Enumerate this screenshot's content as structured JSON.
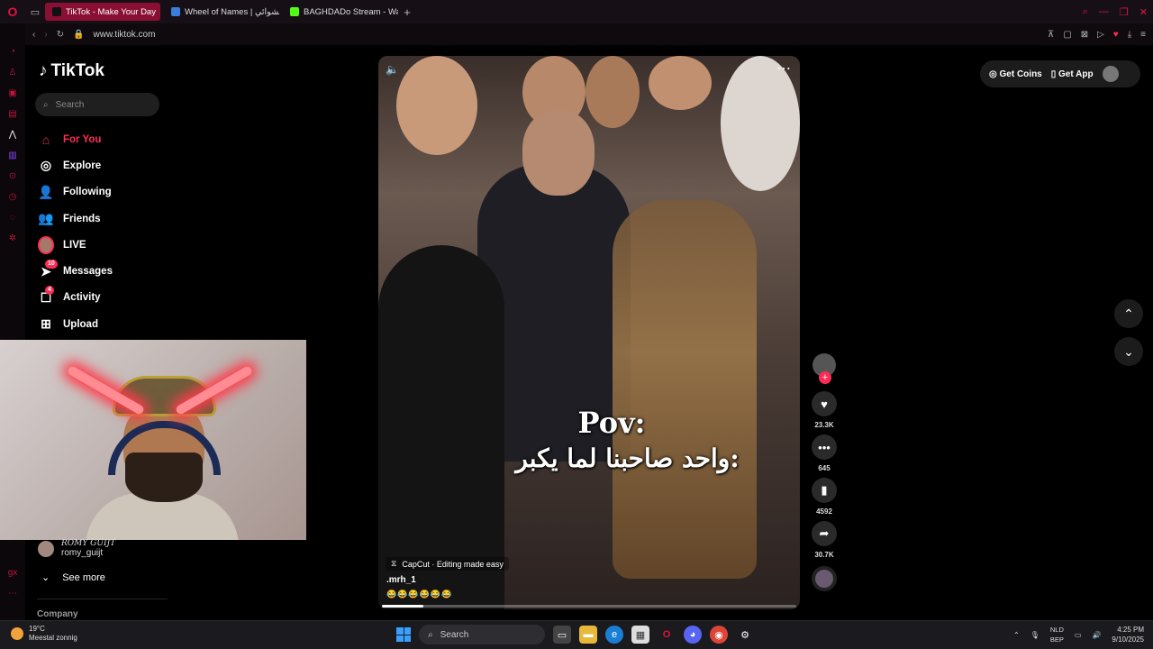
{
  "browser": {
    "tabs": [
      {
        "label": "TikTok - Make Your Day",
        "active": true,
        "favicon_color": "#111111"
      },
      {
        "label": "Wheel of Names | عشوائي",
        "active": false,
        "favicon_color": "#3b7ddd"
      },
      {
        "label": "BAGHDADo Stream - Wat",
        "active": false,
        "favicon_color": "#53fc18"
      }
    ],
    "url": "www.tiktok.com"
  },
  "tiktok": {
    "logo": "TikTok",
    "search_placeholder": "Search",
    "nav": [
      {
        "label": "For You",
        "icon": "home-icon",
        "glyph": "⌂",
        "active": true,
        "badge": ""
      },
      {
        "label": "Explore",
        "icon": "compass-icon",
        "glyph": "◎",
        "active": false,
        "badge": ""
      },
      {
        "label": "Following",
        "icon": "following-icon",
        "glyph": "👤",
        "active": false,
        "badge": ""
      },
      {
        "label": "Friends",
        "icon": "friends-icon",
        "glyph": "👥",
        "active": false,
        "badge": ""
      },
      {
        "label": "LIVE",
        "icon": "live-avatar-icon",
        "glyph": "",
        "active": false,
        "badge": ""
      },
      {
        "label": "Messages",
        "icon": "messages-icon",
        "glyph": "➤",
        "active": false,
        "badge": "10"
      },
      {
        "label": "Activity",
        "icon": "activity-icon",
        "glyph": "☐",
        "active": false,
        "badge": "4"
      },
      {
        "label": "Upload",
        "icon": "upload-icon",
        "glyph": "⊞",
        "active": false,
        "badge": ""
      }
    ],
    "following_account": {
      "display_name": "ROMY GUIJT",
      "handle": "romy_guijt"
    },
    "see_more": "See more",
    "company": "Company",
    "get_coins": "Get Coins",
    "get_app": "Get App"
  },
  "video": {
    "caption_line1": "Pov:",
    "caption_line2": "واحد صاحبنا لما يكبر:",
    "capcut": "CapCut · Editing made easy",
    "author": ".mrh_1",
    "emojis": "😂😂😂😂😂😂",
    "progress": 0.1
  },
  "actions": {
    "likes": "23.3K",
    "comments": "645",
    "saves": "4592",
    "shares": "30.7K"
  },
  "taskbar": {
    "temp": "19°C",
    "weather": "Meestal zonnig",
    "search": "Search",
    "lang1": "NLD",
    "lang2": "BEP",
    "time": "4:25 PM",
    "date": "9/10/2025"
  },
  "colors": {
    "accent": "#fe2c55",
    "opera": "#e0133f"
  }
}
